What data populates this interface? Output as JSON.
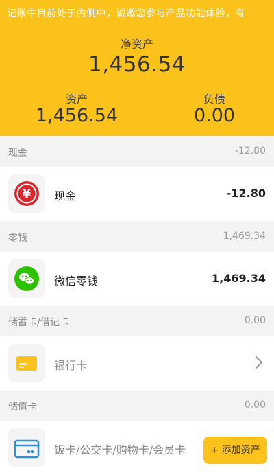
{
  "header": {
    "notice": "记账牛目前处于内侧中，诚邀您参与产品功能体验，有",
    "net_label": "净资产",
    "net_value": "1,456.54",
    "assets_label": "资产",
    "assets_value": "1,456.54",
    "liabilities_label": "负债",
    "liabilities_value": "0.00"
  },
  "sections": [
    {
      "name": "现金",
      "amount": "-12.80",
      "item": {
        "label": "现金",
        "value": "-12.80",
        "icon": "yuan-icon"
      }
    },
    {
      "name": "零钱",
      "amount": "1,469.34",
      "item": {
        "label": "微信零钱",
        "value": "1,469.34",
        "icon": "wechat-icon"
      }
    },
    {
      "name": "储蓄卡/借记卡",
      "amount": "0.00",
      "item": {
        "label": "银行卡",
        "icon": "bank-card-icon"
      }
    },
    {
      "name": "储值卡",
      "amount": "0.00",
      "item": {
        "label": "饭卡/公交卡/购物卡/会员卡",
        "icon": "prepaid-card-icon"
      }
    }
  ],
  "add_button": "+ 添加资产",
  "colors": {
    "accent": "#fcc21c",
    "red": "#d8272c",
    "wechat_green": "#2dc100"
  }
}
